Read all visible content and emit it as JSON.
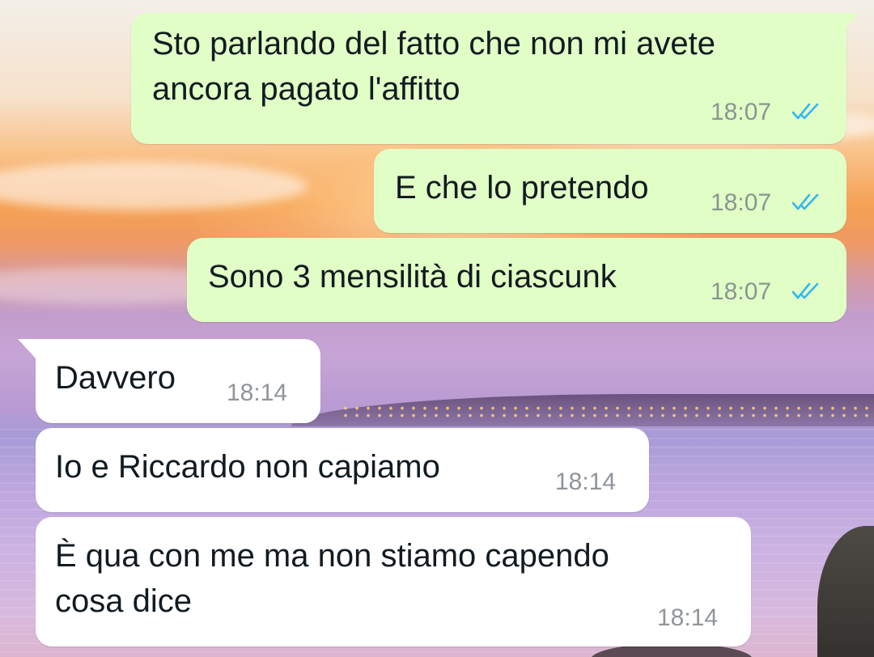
{
  "conversation": {
    "messages": [
      {
        "direction": "outgoing",
        "lines": [
          "Sto parlando del fatto che non mi avete",
          "ancora pagato l'affitto"
        ],
        "time": "18:07",
        "status_icon": "double-check-read-icon"
      },
      {
        "direction": "outgoing",
        "lines": [
          "E che lo pretendo"
        ],
        "time": "18:07",
        "status_icon": "double-check-read-icon"
      },
      {
        "direction": "outgoing",
        "lines": [
          "Sono 3 mensilità di ciascunk"
        ],
        "time": "18:07",
        "status_icon": "double-check-read-icon"
      },
      {
        "direction": "incoming",
        "lines": [
          "Davvero"
        ],
        "time": "18:14"
      },
      {
        "direction": "incoming",
        "lines": [
          "Io e Riccardo non capiamo"
        ],
        "time": "18:14"
      },
      {
        "direction": "incoming",
        "lines": [
          "È qua con me ma non stiamo capendo",
          "cosa dice"
        ],
        "time": "18:14"
      }
    ]
  },
  "colors": {
    "outgoing_bubble": "#e1fec6",
    "incoming_bubble": "#ffffff",
    "read_ticks": "#34b7f1",
    "timestamp": "#8a9690"
  }
}
